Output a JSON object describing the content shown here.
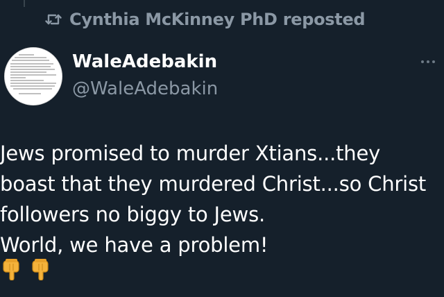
{
  "repost": {
    "text": "Cynthia McKinney PhD reposted",
    "icon": "repost-icon"
  },
  "author": {
    "display_name": "WaleAdebakin",
    "handle": "@WaleAdebakin"
  },
  "tweet": {
    "text": "Jews promised to murder Xtians...they\nboast that they murdered Christ...so Christ\nfollowers no biggy to Jews.\nWorld, we have a problem!",
    "emojis": [
      "backhand-index-pointing-down",
      "backhand-index-pointing-down"
    ]
  },
  "colors": {
    "background": "#15202b",
    "muted": "#8b98a5",
    "text": "#ffffff"
  }
}
